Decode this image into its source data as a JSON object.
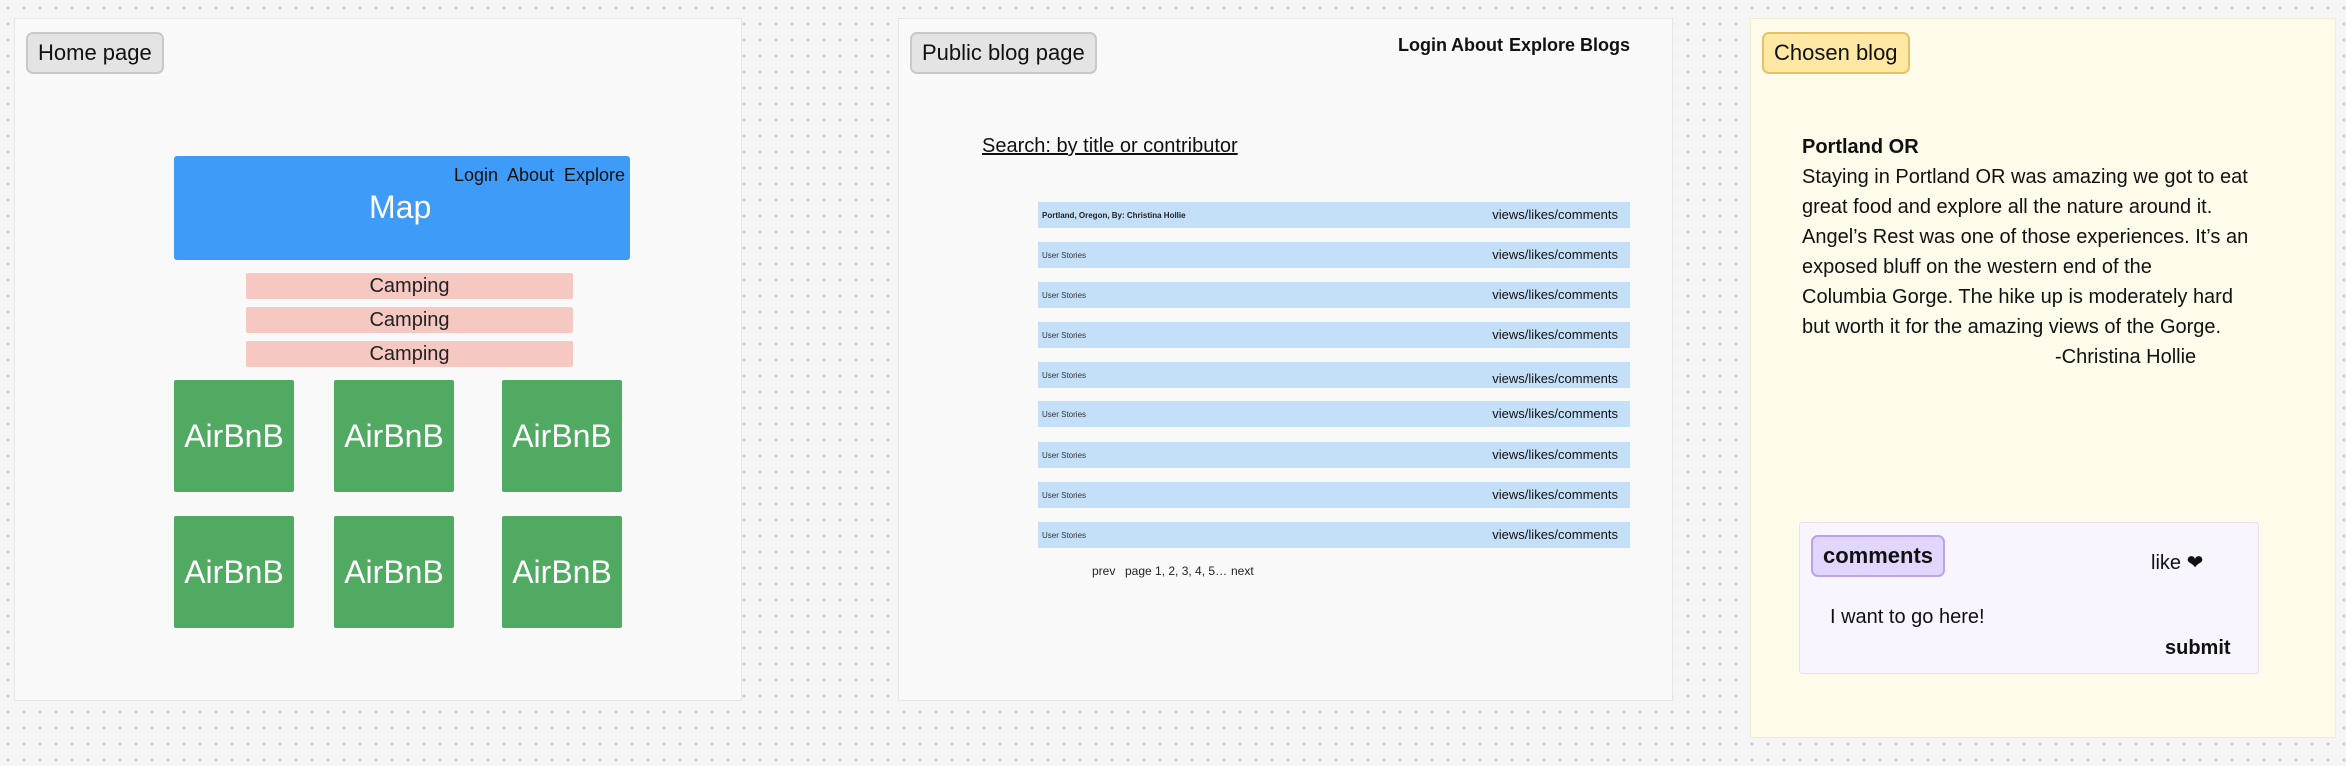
{
  "home": {
    "label": "Home page",
    "map_nav": [
      "Login",
      "About",
      "Explore"
    ],
    "map_label": "Map",
    "camping": [
      "Camping",
      "Camping",
      "Camping"
    ],
    "airbnb": [
      "AirBnB",
      "AirBnB",
      "AirBnB",
      "AirBnB",
      "AirBnB",
      "AirBnB"
    ]
  },
  "blog": {
    "label": "Public blog page",
    "nav": [
      "Login",
      "About",
      "Explore",
      "Blogs"
    ],
    "search": "Search: by title or contributor",
    "rows": [
      {
        "title": "Portland, Oregon, By: Christina Hollie",
        "meta": "views/likes/comments"
      },
      {
        "title": "User Stories",
        "meta": "views/likes/comments"
      },
      {
        "title": "User Stories",
        "meta": "views/likes/comments"
      },
      {
        "title": "User Stories",
        "meta": "views/likes/comments"
      },
      {
        "title": "User Stories",
        "meta": "views/likes/comments"
      },
      {
        "title": "User Stories",
        "meta": "views/likes/comments"
      },
      {
        "title": "User Stories",
        "meta": "views/likes/comments"
      },
      {
        "title": "User Stories",
        "meta": "views/likes/comments"
      },
      {
        "title": "User Stories",
        "meta": "views/likes/comments"
      }
    ],
    "pager": {
      "prev": "prev",
      "pages": "page 1, 2, 3, 4, 5…",
      "next": "next"
    }
  },
  "chosen": {
    "label": "Chosen blog",
    "title": "Portland OR",
    "lines": [
      "Staying in Portland OR was amazing we got to eat",
      "great food and explore all the nature around it.",
      "Angel’s Rest was one of those experiences. It’s an",
      "exposed bluff on the western end of the",
      "Columbia Gorge. The hike up is moderately hard",
      "but worth it for the amazing views of the Gorge."
    ],
    "signature": "-Christina Hollie",
    "comments": {
      "label": "comments",
      "like": "like",
      "text": "I want to go here!",
      "submit": "submit"
    }
  },
  "colors": {
    "map": "#3e9bf8",
    "camping": "#f6c8c2",
    "airbnb": "#50aa62",
    "row": "#c4e0f8",
    "yellow_frame": "#fffbeb",
    "comments_box": "#f8f5ff"
  }
}
